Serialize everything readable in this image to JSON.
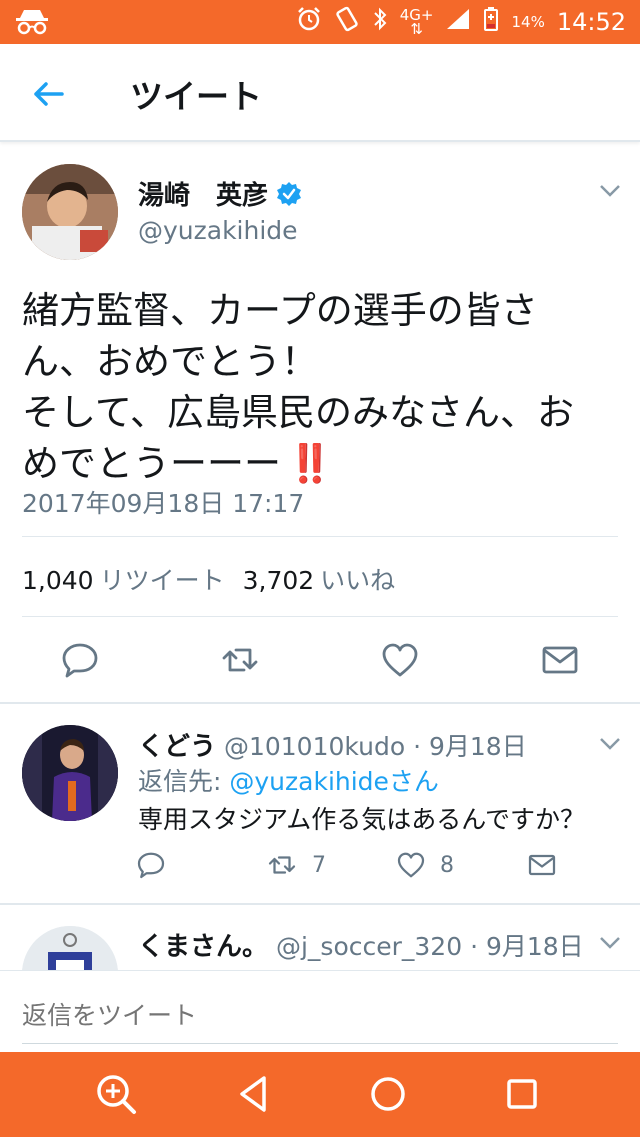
{
  "status_bar": {
    "network": "4G+",
    "battery": "14%",
    "time": "14:52",
    "icons": [
      "incognito-icon",
      "alarm-icon",
      "rotate-icon",
      "bluetooth-icon",
      "signal-icon",
      "battery-icon"
    ]
  },
  "header": {
    "title": "ツイート",
    "back_icon": "arrow-left-icon"
  },
  "tweet": {
    "author_name": "湯崎　英彦",
    "handle": "@yuzakihide",
    "verified": true,
    "text_lines": [
      "緒方監督、カープの選手の皆さ",
      "ん、おめでとう！",
      "そして、広島県民のみなさん、お",
      "めでとうーーー"
    ],
    "exclamation": "‼️",
    "timestamp": "2017年09月18日 17:17",
    "retweets_count": "1,040",
    "retweets_label": "リツイート",
    "likes_count": "3,702",
    "likes_label": "いいね",
    "accent": "#1da1f2"
  },
  "replies": [
    {
      "name": "くどう",
      "handle": "@101010kudo",
      "date": "9月18日",
      "reply_to_label": "返信先:",
      "reply_to_mention": "@yuzakihideさん",
      "text": "専用スタジアム作る気はあるんですか？",
      "retweets": "7",
      "likes": "8"
    },
    {
      "name": "くまさん。",
      "handle": "@j_soccer_320",
      "date": "9月18日"
    }
  ],
  "compose": {
    "placeholder": "返信をツイート"
  },
  "colors": {
    "status_bar": "#f4692a",
    "text_secondary": "#657786"
  }
}
